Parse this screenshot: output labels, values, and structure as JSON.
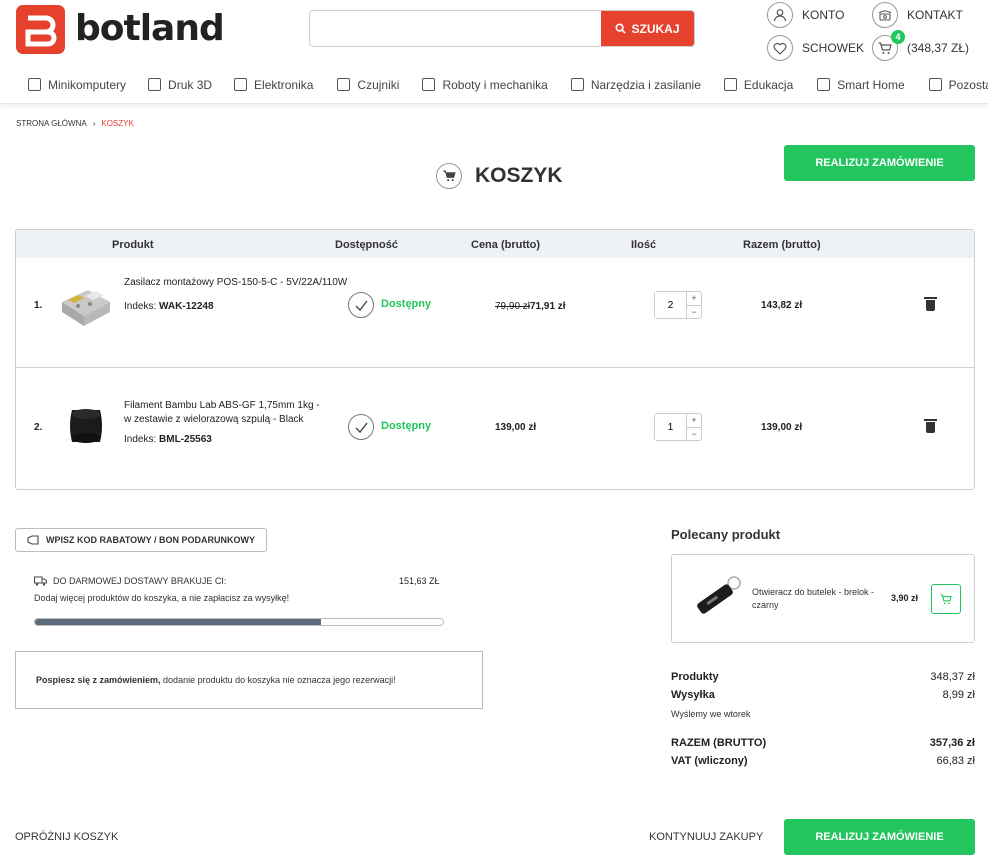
{
  "brand": {
    "name": "botland",
    "accent": "#e5412d",
    "green": "#22c55e"
  },
  "header": {
    "search_placeholder": "",
    "search_button": "SZUKAJ",
    "account": "KONTO",
    "contact": "KONTAKT",
    "wishlist": "SCHOWEK",
    "cart_total": "(348,37 ZŁ)",
    "cart_count": "4"
  },
  "nav": [
    {
      "label": "Minikomputery",
      "icon": "minicomputer-icon"
    },
    {
      "label": "Druk 3D",
      "icon": "cube-icon"
    },
    {
      "label": "Elektronika",
      "icon": "chip-icon"
    },
    {
      "label": "Czujniki",
      "icon": "thermometer-icon"
    },
    {
      "label": "Roboty i mechanika",
      "icon": "robot-icon"
    },
    {
      "label": "Narzędzia i zasilanie",
      "icon": "tools-icon"
    },
    {
      "label": "Edukacja",
      "icon": "brain-icon"
    },
    {
      "label": "Smart Home",
      "icon": "smart-home-icon"
    },
    {
      "label": "Pozostałe",
      "icon": "bulb-icon"
    }
  ],
  "breadcrumb": {
    "home": "STRONA GŁÓWNA",
    "current": "KOSZYK"
  },
  "page_title": "KOSZYK",
  "checkout_label": "REALIZUJ ZAMÓWIENIE",
  "table": {
    "headers": {
      "product": "Produkt",
      "availability": "Dostępność",
      "price": "Cena (brutto)",
      "qty": "Ilość",
      "total": "Razem (brutto)"
    },
    "rows": [
      {
        "num": "1.",
        "name": "Zasilacz montażowy POS-150-5-C - 5V/22A/110W",
        "index_label": "Indeks:",
        "index": "WAK-12248",
        "availability": "Dostępny",
        "old_price": "79,90 zł",
        "price": "71,91 zł",
        "qty": "2",
        "total": "143,82 zł"
      },
      {
        "num": "2.",
        "name": "Filament Bambu Lab ABS-GF 1,75mm 1kg - w zestawie z wielorazową szpulą - Black",
        "index_label": "Indeks:",
        "index": "BML-25563",
        "availability": "Dostępny",
        "old_price": "",
        "price": "139,00 zł",
        "qty": "1",
        "total": "139,00 zł"
      }
    ]
  },
  "coupon_label": "WPISZ KOD RABATOWY / BON PODARUNKOWY",
  "shipping": {
    "label": "DO DARMOWEJ DOSTAWY BRAKUJE CI:",
    "missing": "151,63 ZŁ",
    "hint": "Dodaj więcej produktów do koszyka, a nie zapłacisz za wysyłkę!",
    "progress": 0.7
  },
  "notice": {
    "bold": "Pospiesz się z zamówieniem,",
    "text": " dodanie produktu do koszyka nie oznacza jego rezerwacji!"
  },
  "recommended": {
    "heading": "Polecany produkt",
    "name": "Otwieracz do butelek - brelok - czarny",
    "price": "3,90 zł"
  },
  "summary": {
    "products_label": "Produkty",
    "products": "348,37 zł",
    "shipping_label": "Wysyłka",
    "shipping": "8,99 zł",
    "shipping_note": "Wyślemy we wtorek",
    "total_label": "RAZEM (BRUTTO)",
    "total": "357,36 zł",
    "vat_label": "VAT (wliczony)",
    "vat": "66,83 zł"
  },
  "footer": {
    "empty_cart": "OPRÓŻNIJ KOSZYK",
    "continue": "KONTYNUUJ ZAKUPY"
  }
}
